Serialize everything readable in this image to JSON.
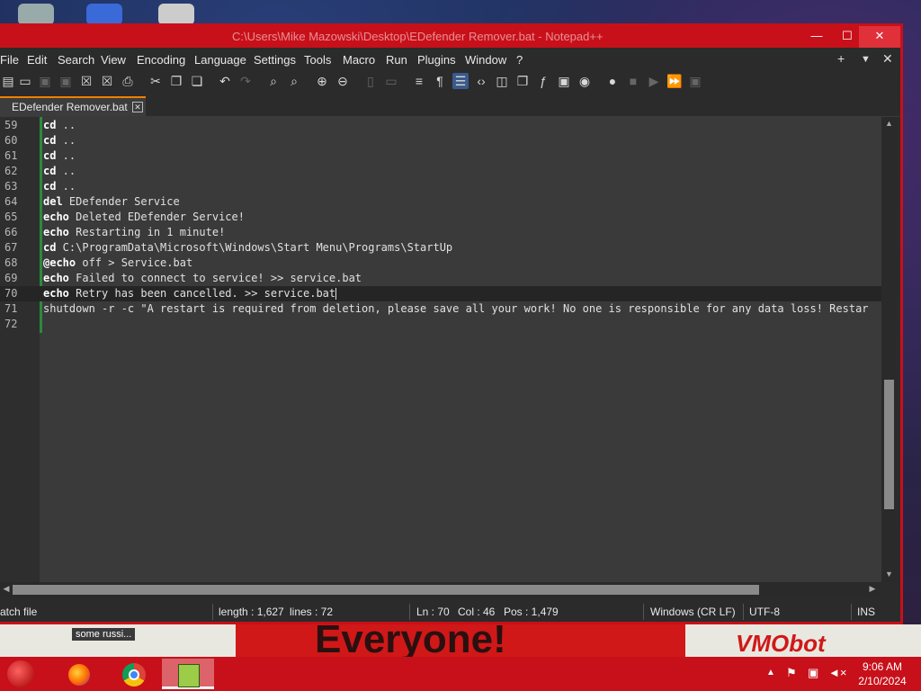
{
  "window": {
    "title": "C:\\Users\\Mike Mazowski\\Desktop\\EDefender Remover.bat - Notepad++",
    "minimize": "—",
    "maximize": "☐",
    "close": "✕"
  },
  "menu": [
    "File",
    "Edit",
    "Search",
    "View",
    "Encoding",
    "Language",
    "Settings",
    "Tools",
    "Macro",
    "Run",
    "Plugins",
    "Window",
    "?"
  ],
  "menu_right": {
    "plus": "+",
    "down": "▼",
    "close": "✕"
  },
  "tab": {
    "label": "EDefender Remover.bat",
    "close": "✕"
  },
  "lines": [
    {
      "n": "59",
      "kw": "cd",
      "rest": " .."
    },
    {
      "n": "60",
      "kw": "cd",
      "rest": " .."
    },
    {
      "n": "61",
      "kw": "cd",
      "rest": " .."
    },
    {
      "n": "62",
      "kw": "cd",
      "rest": " .."
    },
    {
      "n": "63",
      "kw": "cd",
      "rest": " .."
    },
    {
      "n": "64",
      "kw": "del",
      "rest": " EDefender Service"
    },
    {
      "n": "65",
      "kw": "echo",
      "rest": " Deleted EDefender Service!"
    },
    {
      "n": "66",
      "kw": "echo",
      "rest": " Restarting in 1 minute!"
    },
    {
      "n": "67",
      "kw": "cd",
      "rest": " C:\\ProgramData\\Microsoft\\Windows\\Start Menu\\Programs\\StartUp"
    },
    {
      "n": "68",
      "kw": "@echo",
      "rest": " off > Service.bat"
    },
    {
      "n": "69",
      "kw": "echo",
      "rest": " Failed to connect to service! >> service.bat"
    },
    {
      "n": "70",
      "kw": "echo",
      "rest": " Retry has been cancelled. >> service.bat"
    },
    {
      "n": "71",
      "kw": "",
      "rest": "shutdown -r -c \"A restart is required from deletion, please save all your work! No one is responsible for any data loss! Restar"
    },
    {
      "n": "72",
      "kw": "",
      "rest": ""
    }
  ],
  "status": {
    "type": "atch file",
    "length": "length : 1,627",
    "lines": "lines : 72",
    "ln": "Ln : 70",
    "col": "Col : 46",
    "pos": "Pos : 1,479",
    "eol": "Windows (CR LF)",
    "encoding": "UTF-8",
    "mode": "INS"
  },
  "banner": {
    "text": "Everyone!",
    "vm": "VMObot"
  },
  "tooltip": "some russi...",
  "clock": {
    "time": "9:06 AM",
    "date": "2/10/2024"
  },
  "icons": [
    "start-orb",
    "firefox-icon",
    "chrome-icon",
    "notepadpp-icon"
  ]
}
